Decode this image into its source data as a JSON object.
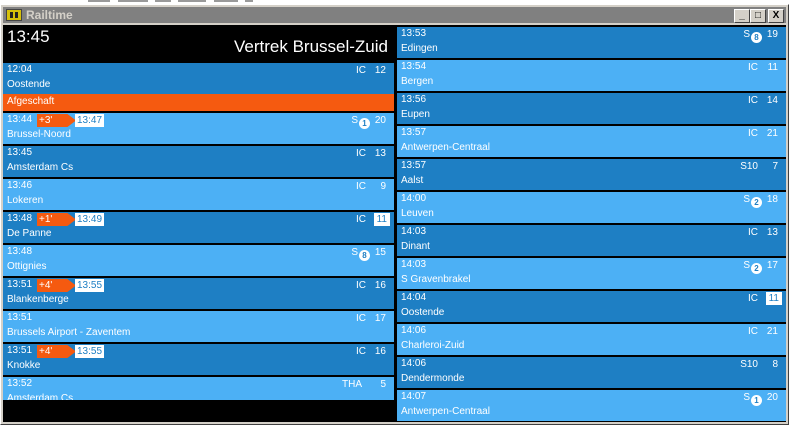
{
  "window": {
    "title": "Railtime",
    "minimize": "_",
    "maximize": "□",
    "close": "X"
  },
  "board": {
    "current_time": "13:45",
    "title": "Vertrek Brussel-Zuid"
  },
  "left": [
    {
      "time": "12:04",
      "destination": "Oostende",
      "type": "IC",
      "number": "12",
      "status": "Afgeschaft"
    },
    {
      "time": "13:44",
      "destination": "Brussel-Noord",
      "type": "S",
      "line": "1",
      "number": "20",
      "delay": "+3'",
      "new_time": "13:47"
    },
    {
      "time": "13:45",
      "destination": "Amsterdam Cs",
      "type": "IC",
      "number": "13"
    },
    {
      "time": "13:46",
      "destination": "Lokeren",
      "type": "IC",
      "number": "9"
    },
    {
      "time": "13:48",
      "destination": "De Panne",
      "type": "IC",
      "number": "11",
      "delay": "+1'",
      "new_time": "13:49"
    },
    {
      "time": "13:48",
      "destination": "Ottignies",
      "type": "S",
      "line": "8",
      "number": "15"
    },
    {
      "time": "13:51",
      "destination": "Blankenberge",
      "type": "IC",
      "number": "16",
      "delay": "+4'",
      "new_time": "13:55"
    },
    {
      "time": "13:51",
      "destination": "Brussels Airport - Zaventem",
      "type": "IC",
      "number": "17"
    },
    {
      "time": "13:51",
      "destination": "Knokke",
      "type": "IC",
      "number": "16",
      "delay": "+4'",
      "new_time": "13:55"
    },
    {
      "time": "13:52",
      "destination": "Amsterdam Cs",
      "type": "THA",
      "number": "5"
    }
  ],
  "right": [
    {
      "time": "13:53",
      "destination": "Edingen",
      "type": "S",
      "line": "8",
      "number": "19"
    },
    {
      "time": "13:54",
      "destination": "Bergen",
      "type": "IC",
      "number": "11"
    },
    {
      "time": "13:56",
      "destination": "Eupen",
      "type": "IC",
      "number": "14"
    },
    {
      "time": "13:57",
      "destination": "Antwerpen-Centraal",
      "type": "IC",
      "number": "21"
    },
    {
      "time": "13:57",
      "destination": "Aalst",
      "type": "S10",
      "number": "7"
    },
    {
      "time": "14:00",
      "destination": "Leuven",
      "type": "S",
      "line": "2",
      "number": "18"
    },
    {
      "time": "14:03",
      "destination": "Dinant",
      "type": "IC",
      "number": "13"
    },
    {
      "time": "14:03",
      "destination": "S Gravenbrakel",
      "type": "S",
      "line": "2",
      "number": "17"
    },
    {
      "time": "14:04",
      "destination": "Oostende",
      "type": "IC",
      "number": "11"
    },
    {
      "time": "14:06",
      "destination": "Charleroi-Zuid",
      "type": "IC",
      "number": "21"
    },
    {
      "time": "14:06",
      "destination": "Dendermonde",
      "type": "S10",
      "number": "8"
    },
    {
      "time": "14:07",
      "destination": "Antwerpen-Centraal",
      "type": "S",
      "line": "1",
      "number": "20"
    }
  ],
  "colors": {
    "row_dark": "#1e7fc4",
    "row_light": "#4cb0f5",
    "alert": "#f55a10",
    "background": "#000000"
  }
}
